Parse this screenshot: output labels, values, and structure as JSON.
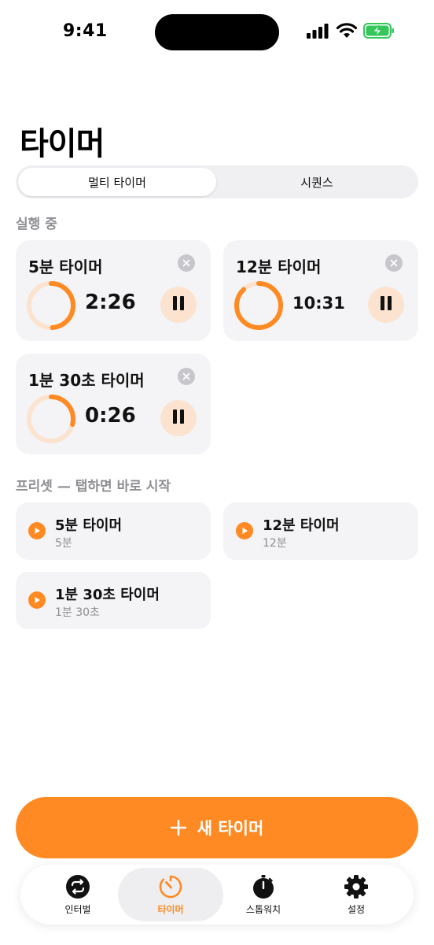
{
  "status_bar": {
    "time": "9:41"
  },
  "page": {
    "title": "타이머"
  },
  "segmented": {
    "options": [
      "멀티 타이머",
      "시퀀스"
    ],
    "selected": "멀티 타이머"
  },
  "running": {
    "section_label": "실행 중",
    "timers": [
      {
        "title": "5분 타이머",
        "remaining": "2:26",
        "progress": 0.49
      },
      {
        "title": "12분 타이머",
        "remaining": "10:31",
        "progress": 0.88
      },
      {
        "title": "1분 30초 타이머",
        "remaining": "0:26",
        "progress": 0.29
      }
    ]
  },
  "presets": {
    "section_label": "프리셋 — 탭하면 바로 시작",
    "items": [
      {
        "title": "5분 타이머",
        "subtitle": "5분"
      },
      {
        "title": "12분 타이머",
        "subtitle": "12분"
      },
      {
        "title": "1분 30초 타이머",
        "subtitle": "1분 30초"
      }
    ]
  },
  "new_timer_button": {
    "label": "새 타이머"
  },
  "tab_bar": {
    "items": [
      {
        "label": "인터벌",
        "icon": "repeat-icon"
      },
      {
        "label": "타이머",
        "icon": "timer-icon"
      },
      {
        "label": "스톱워치",
        "icon": "stopwatch-icon"
      },
      {
        "label": "설정",
        "icon": "gear-icon"
      }
    ],
    "active": "타이머"
  },
  "colors": {
    "accent": "#ff8a23",
    "accent_light": "#fbe3cf",
    "card_bg": "#f4f4f6",
    "secondary_text": "#8e8e93"
  }
}
